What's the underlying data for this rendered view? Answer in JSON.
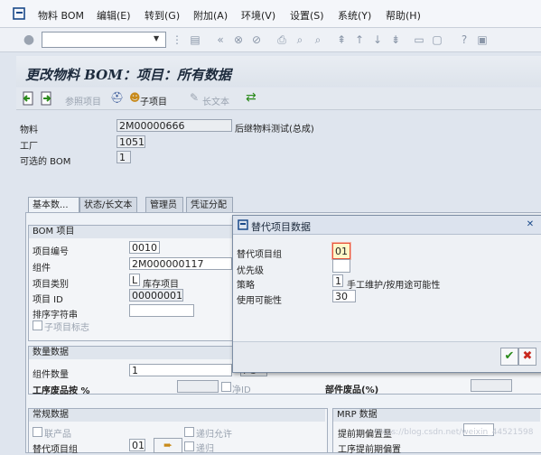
{
  "menubar": {
    "items": [
      "物料 BOM",
      "编辑(E)",
      "转到(G)",
      "附加(A)",
      "环境(V)",
      "设置(S)",
      "系统(Y)",
      "帮助(H)"
    ]
  },
  "toolbar": {
    "command_value": ""
  },
  "screen": {
    "title": "更改物料 BOM：项目：所有数据"
  },
  "app_toolbar": {
    "ref_item": "参照项目",
    "sub_item": "子项目",
    "long_text": "长文本"
  },
  "header": {
    "material_label": "物料",
    "material_value": "2M00000666",
    "material_desc": "后继物料测试(总成)",
    "plant_label": "工厂",
    "plant_value": "1051",
    "alt_bom_label": "可选的 BOM",
    "alt_bom_value": "1"
  },
  "tabs": [
    "基本数...",
    "状态/长文本",
    "管理员",
    "凭证分配"
  ],
  "bom_item": {
    "header": "BOM 项目",
    "item_no_label": "项目编号",
    "item_no_value": "0010",
    "component_label": "组件",
    "component_value": "2M000000117",
    "item_cat_label": "项目类别",
    "item_cat_value": "L",
    "item_cat_desc": "库存项目",
    "item_id_label": "项目 ID",
    "item_id_value": "00000001",
    "sort_label": "排序字符串",
    "sort_value": "",
    "sub_item_flag": "子项目标志"
  },
  "quantity": {
    "header": "数量数据",
    "qty_label": "组件数量",
    "qty_value": "1",
    "unit_value": "PC",
    "scrap_label": "工序废品按 %",
    "net_id": "净ID",
    "comp_scrap_label": "部件废品(%)"
  },
  "general": {
    "header": "常规数据",
    "byproduct": "联产品",
    "recursive_allowed": "递归允许",
    "recursive": "递归",
    "alt_group_label": "替代项目组",
    "alt_group_value": "01"
  },
  "mrp": {
    "header": "MRP 数据",
    "lead_offset": "提前期偏置量",
    "op_lead_offset": "工序提前期偏置"
  },
  "dialog": {
    "title": "替代项目数据",
    "group_label": "替代项目组",
    "group_value": "01",
    "priority_label": "优先级",
    "priority_value": "",
    "strategy_label": "策略",
    "strategy_value": "1",
    "strategy_desc": "手工维护/按用途可能性",
    "usage_prob_label": "使用可能性",
    "usage_prob_value": "30"
  },
  "watermark": "https://blog.csdn.net/weixin_44521598",
  "colors": {
    "accept": "#2a8a1a",
    "cancel": "#c8281e",
    "highlight": "#e5533d"
  }
}
